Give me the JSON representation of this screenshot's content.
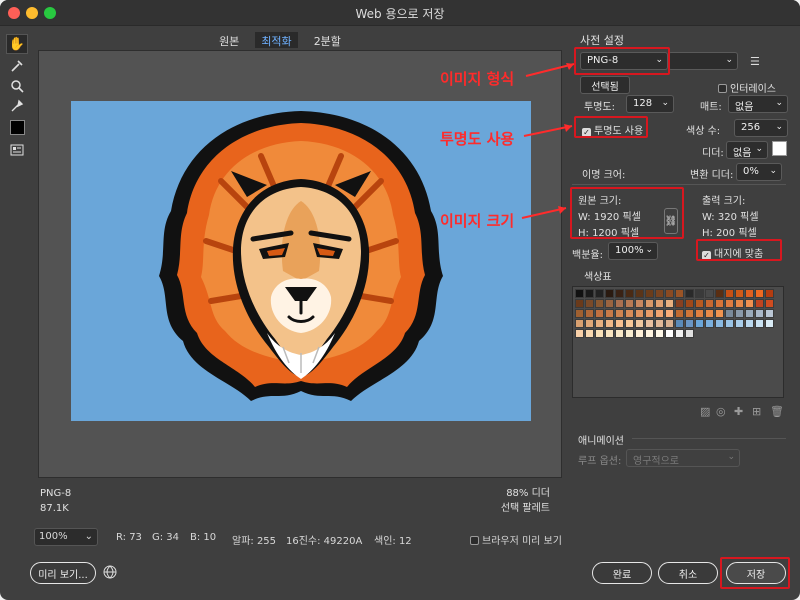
{
  "window": {
    "title": "Web 용으로 저장"
  },
  "view_tabs": [
    {
      "label": "원본"
    },
    {
      "label": "최적화",
      "selected": true
    },
    {
      "label": "2분할"
    }
  ],
  "tools": [
    "hand-icon",
    "slice-select-icon",
    "zoom-icon",
    "eyedropper-icon",
    "color-swatch",
    "toggle-slices-icon"
  ],
  "image_info": {
    "format": "PNG-8",
    "size": "87.1K",
    "dither": "88% 디더",
    "palette": "선택 팔레트"
  },
  "status": {
    "zoom": "100%",
    "r": "R: 73",
    "g": "G: 34",
    "b": "B: 10",
    "alpha": "알파: 255",
    "hex": "16진수: 49220A",
    "index": "색인: 12",
    "browser_preview": "브라우저 미리 보기"
  },
  "buttons": {
    "preview": "미리 보기...",
    "done": "완료",
    "cancel": "취소",
    "save": "저장"
  },
  "panel": {
    "preset_label": "사전 설정",
    "format": "PNG-8",
    "selective": "선택됨",
    "interlace": "인터레이스",
    "transparency_label": "투명도:",
    "transparency_value": "128",
    "matte_label": "매트:",
    "matte_value": "없음",
    "use_transparency": "투명도 사용",
    "colors_label": "색상 수:",
    "colors_value": "256",
    "dither_label": "디더:",
    "dither_value": "없음",
    "transparency_dither": "이명 크어:",
    "lossy_label": "변환 디더:",
    "lossy_value": "0%",
    "orig_size_label": "원본 크기:",
    "orig_w": "W:  1920  픽셀",
    "orig_h": "H:  1200  픽셀",
    "out_size_label": "출력 크기:",
    "out_w": "W:  320   픽셀",
    "out_h": "H:  200   픽셀",
    "percent_label": "백분율:",
    "percent_value": "100%",
    "fit_label": "대지에 맞춤",
    "color_table_label": "색상표",
    "animation_label": "애니메이션",
    "loop_label": "루프 옵션:",
    "loop_value": "영구적으로"
  },
  "annotations": {
    "image_format": "이미지 형식",
    "use_transparency": "투명도 사용",
    "image_size": "이미지 크기",
    "color": "#ff2b2b"
  },
  "colors": {
    "accent": "#6fb1ff",
    "canvas_bg": "#535353",
    "image_bg": "#6aa6d9",
    "highlight": "#d7171f"
  },
  "color_table": [
    "#111111",
    "#1a1a1a",
    "#222222",
    "#2a1a10",
    "#3a2214",
    "#4a2a14",
    "#5a3418",
    "#6b3c1a",
    "#7a4420",
    "#8a4a22",
    "#9a5426",
    "#2a2a2a",
    "#3a3a3a",
    "#4a4a4a",
    "#5a2e12",
    "#c85014",
    "#d05a18",
    "#e06020",
    "#f06a22",
    "#b43c10",
    "#6a3a1a",
    "#7a4a28",
    "#8a5830",
    "#9a6440",
    "#aa7050",
    "#b87a54",
    "#c88860",
    "#d89868",
    "#e0a070",
    "#e8b080",
    "#884020",
    "#a04818",
    "#b85a20",
    "#c86830",
    "#d87438",
    "#e07c40",
    "#e88848",
    "#f09050",
    "#c04420",
    "#d04c20",
    "#a06030",
    "#b06838",
    "#c07040",
    "#c87a48",
    "#d08450",
    "#d88c58",
    "#e09460",
    "#e89c68",
    "#f0a470",
    "#f8ac78",
    "#c06a30",
    "#d07638",
    "#e08040",
    "#e88a48",
    "#f09450",
    "#7a8a9a",
    "#8a9aaa",
    "#9aaaba",
    "#aab8c8",
    "#bac6d4",
    "#d8a070",
    "#e0a878",
    "#e8b080",
    "#f0b888",
    "#f8c090",
    "#f8c898",
    "#f0c8a0",
    "#e8c0a0",
    "#e0b898",
    "#d8b090",
    "#5a8ab8",
    "#6a96c4",
    "#6aa6d9",
    "#7ab0de",
    "#8abae2",
    "#9ac4e6",
    "#aaceea",
    "#bad8ee",
    "#cae2f2",
    "#daecf6",
    "#f8d0a8",
    "#f8d8b0",
    "#f8e0b8",
    "#f8e4c0",
    "#f8e8c8",
    "#f8ecd0",
    "#fef0d8",
    "#fef4e0",
    "#fef8e8",
    "#ffffff",
    "#f0f0f0",
    "#e0e0e0"
  ]
}
